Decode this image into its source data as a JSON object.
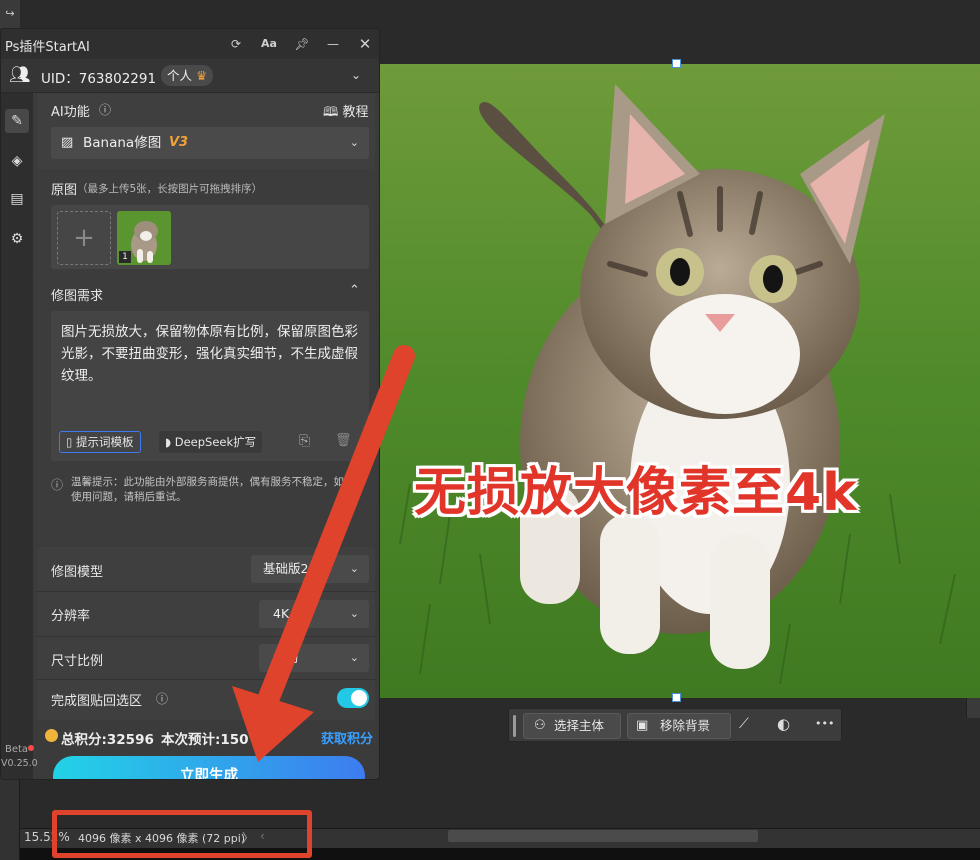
{
  "ps": {
    "topleft_glyph": "↪",
    "zoom": "15.52%",
    "doc_size": "4096 像素 x 4096 像素 (72 ppi)",
    "status_chevron": "〉",
    "status_chevron_left": "‹"
  },
  "canvas": {
    "overlay_text": "无损放大像素至4k",
    "overlay_color": "#e2352a"
  },
  "context_bar": {
    "select_subject": "选择主体",
    "remove_bg": "移除背景",
    "more": "•••"
  },
  "plugin": {
    "title": "Ps插件StartAI",
    "uid_label": "UID：763802291",
    "plan_badge": "个人",
    "ai_function_label": "AI功能",
    "tutorial": "教程",
    "model_select": "Banana修图",
    "model_version": "V3",
    "source_label": "原图",
    "source_hint": "（最多上传5张，长按图片可拖拽排序）",
    "thumb_index": "1",
    "edit_req_label": "修图需求",
    "edit_req_text": "图片无损放大，保留物体原有比例，保留原图色彩光影，不要扭曲变形，强化真实细节，不生成虚假纹理。",
    "prompt_template_btn": "提示词模板",
    "deepseek_btn": "DeepSeek扩写",
    "notice": "温馨提示：此功能由外部服务商提供，偶有服务不稳定，如遇使用问题，请稍后重试。",
    "edit_model_label": "修图模型",
    "edit_model_value": "基础版2.0",
    "resolution_label": "分辨率",
    "resolution_value": "4K",
    "ratio_label": "尺寸比例",
    "ratio_value": "自动",
    "paste_back_label": "完成图贴回选区",
    "paste_back_on": true,
    "points_text": "总积分:32596",
    "estimate_text": "本次预计:150",
    "get_points": "获取积分",
    "generate_btn": "立即生成",
    "beta": "Beta",
    "version": "V0.25.0"
  },
  "colors": {
    "accent_cyan": "#22d3e6",
    "accent_blue": "#3d7cf0",
    "link_blue": "#3aa0ff",
    "arrow_red": "#e0432b",
    "badge_orange": "#f0a13a"
  }
}
